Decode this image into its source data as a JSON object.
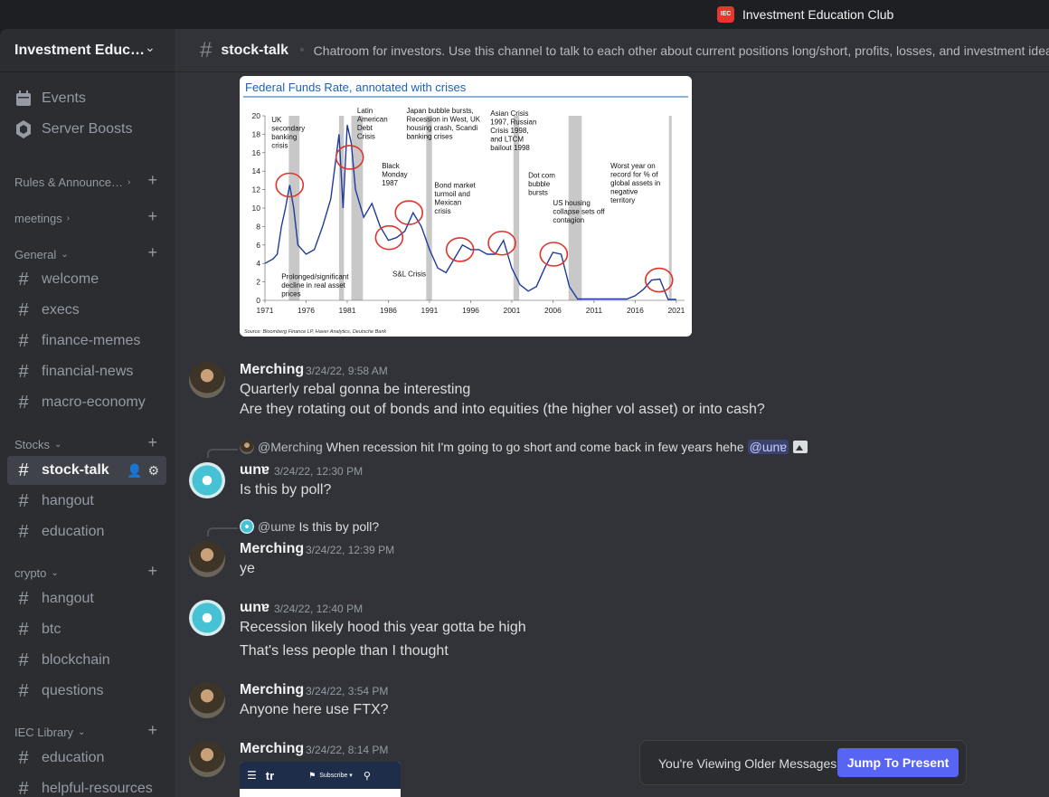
{
  "window": {
    "title": "Investment Education Club",
    "logo_text": "IEC"
  },
  "server": {
    "name": "Investment Education Club"
  },
  "sidebar": {
    "top_items": [
      {
        "label": "Events",
        "icon": "calendar-icon"
      },
      {
        "label": "Server Boosts",
        "icon": "boost-icon"
      }
    ],
    "categories": [
      {
        "label": "Rules & Announcements",
        "collapsed": true,
        "channels": []
      },
      {
        "label": "meetings",
        "collapsed": true,
        "channels": []
      },
      {
        "label": "General",
        "collapsed": false,
        "channels": [
          "welcome",
          "execs",
          "finance-memes",
          "financial-news",
          "macro-economy"
        ]
      },
      {
        "label": "Stocks",
        "collapsed": false,
        "channels": [
          "stock-talk",
          "hangout",
          "education"
        ]
      },
      {
        "label": "crypto",
        "collapsed": false,
        "channels": [
          "hangout",
          "btc",
          "blockchain",
          "questions"
        ]
      },
      {
        "label": "IEC Library",
        "collapsed": false,
        "channels": [
          "education",
          "helpful-resources"
        ]
      }
    ],
    "active_channel": "stock-talk"
  },
  "header": {
    "channel": "stock-talk",
    "topic": "Chatroom for investors. Use this channel to talk to each other about current positions long/short, profits, losses, and investment ideas."
  },
  "chart_image": {
    "title": "Federal Funds Rate, annotated with crises",
    "source": "Source: Bloomberg Finance LP, Haver Analytics, Deutsche Bank",
    "chart_data": {
      "type": "line",
      "title": "Federal Funds Rate, annotated with crises",
      "x_ticks": [
        "1971",
        "1976",
        "1981",
        "1986",
        "1991",
        "1996",
        "2001",
        "2006",
        "2011",
        "2016",
        "2021"
      ],
      "y_ticks": [
        "0",
        "2",
        "4",
        "6",
        "8",
        "10",
        "12",
        "14",
        "16",
        "18",
        "20"
      ],
      "ylim": [
        0,
        20
      ],
      "xlim": [
        1971,
        2022
      ],
      "series": [
        {
          "x": [
            1971,
            1972,
            1972.5,
            1973,
            1973.5,
            1974,
            1974.5,
            1975,
            1976,
            1977,
            1978,
            1979,
            1980,
            1980.5,
            1981,
            1981.5,
            1982,
            1983,
            1984,
            1985,
            1986,
            1987,
            1988,
            1989,
            1990,
            1991,
            1992,
            1993,
            1994,
            1995,
            1996,
            1997,
            1998,
            1999,
            2000,
            2001,
            2002,
            2003,
            2004,
            2005,
            2006,
            2007,
            2008,
            2009,
            2012,
            2015,
            2016,
            2017,
            2018,
            2019,
            2020,
            2021
          ],
          "y": [
            4,
            4.5,
            5,
            8,
            10,
            12.5,
            10,
            6,
            5,
            5.5,
            8,
            11,
            18,
            10,
            19,
            17,
            12,
            9,
            10.5,
            8,
            6.5,
            6.8,
            7.5,
            9.5,
            8,
            5.5,
            3.5,
            3,
            4.5,
            6,
            5.5,
            5.5,
            5,
            5,
            6.5,
            3.5,
            1.7,
            1,
            1.5,
            3.5,
            5.2,
            5,
            1.5,
            0.15,
            0.15,
            0.15,
            0.5,
            1.2,
            2.2,
            2.3,
            0.1,
            0.1
          ]
        }
      ],
      "shaded_periods": [
        [
          1973.9,
          1975.2
        ],
        [
          1980.0,
          1980.6
        ],
        [
          1981.5,
          1982.9
        ],
        [
          1990.6,
          1991.3
        ],
        [
          2001.2,
          2001.9
        ],
        [
          2007.9,
          2009.5
        ],
        [
          2020.1,
          2020.4
        ]
      ],
      "annotations": [
        "UK secondary banking crisis",
        "Latin American Debt Crisis",
        "Black Monday 1987",
        "Japan bubble bursts, Recession in West, UK housing crash, Scandi banking crises",
        "Bond market turmoil and Mexican crisis",
        "Asian Crisis 1997, Russian Crisis 1998, and LTCM bailout 1998",
        "Dot com bubble bursts",
        "US housing collapse sets off contagion",
        "Worst year on record for % of global assets in negative territory",
        "S&L Crisis",
        "Prolonged/significant decline in real asset prices"
      ]
    }
  },
  "messages": [
    {
      "author": "Merching",
      "time": "3/24/22, 9:58 AM",
      "lines": [
        "Quarterly rebal gonna be interesting",
        "Are they rotating out of bonds and into equities (the higher vol asset) or into cash?"
      ]
    },
    {
      "author": "ɯnɐ",
      "time": "3/24/22, 12:30 PM",
      "reply": {
        "author": "@Merching",
        "text": "When recession hit I'm going to go short and come back in few years hehe",
        "mention": "@ɯnɐ"
      },
      "lines": [
        "Is this by poll?"
      ]
    },
    {
      "author": "Merching",
      "time": "3/24/22, 12:39 PM",
      "reply": {
        "author": "@ɯnɐ",
        "text": "Is this by poll?"
      },
      "lines": [
        "ye"
      ]
    },
    {
      "author": "ɯnɐ",
      "time": "3/24/22, 12:40 PM",
      "lines": [
        "Recession likely hood this year gotta be high",
        "That's less people than I thought"
      ]
    },
    {
      "author": "Merching",
      "time": "3/24/22, 3:54 PM",
      "lines": [
        "Anyone here use FTX?"
      ]
    },
    {
      "author": "Merching",
      "time": "3/24/22, 8:14 PM",
      "lines": []
    }
  ],
  "embed": {
    "logo": "tr",
    "button": "Subscribe ▾"
  },
  "older_bar": {
    "text": "You're Viewing Older Messages",
    "button": "Jump To Present"
  },
  "colors": {
    "accent": "#5865f2",
    "chart_line": "#1f3b9c",
    "crisis_circle": "#e0332b",
    "shade": "#c8c8c8"
  }
}
